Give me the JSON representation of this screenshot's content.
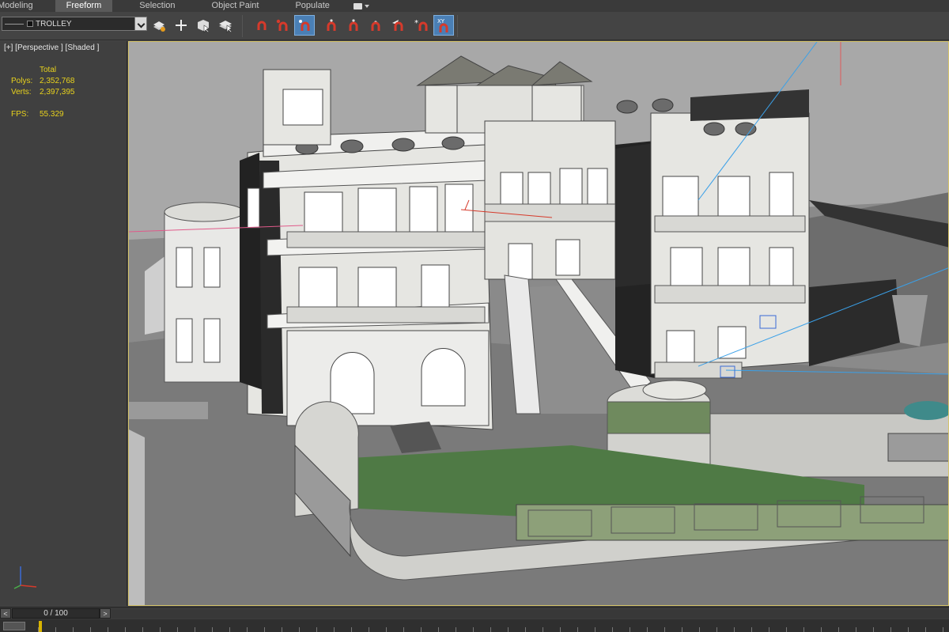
{
  "ribbon": {
    "tabs": [
      {
        "label": "Modeling"
      },
      {
        "label": "Freeform"
      },
      {
        "label": "Selection"
      },
      {
        "label": "Object Paint"
      },
      {
        "label": "Populate"
      }
    ],
    "active_tab": "Freeform"
  },
  "toolbar": {
    "object_name": "TROLLEY",
    "magnet_active_index": 2,
    "xy_label": "XY"
  },
  "viewport": {
    "label": "[+] [Perspective ] [Shaded ]",
    "stats": {
      "total_label": "Total",
      "polys_label": "Polys:",
      "polys_value": "2,352,768",
      "verts_label": "Verts:",
      "verts_value": "2,397,395",
      "fps_label": "FPS:",
      "fps_value": "55.329"
    },
    "colors": {
      "stats_text": "#e8d21d",
      "active_border": "#d6c46a",
      "ground": "#7a7a7a",
      "lawn": "#4f7a45"
    }
  },
  "timeline": {
    "frame_display": "0 / 100",
    "prev_label": "<",
    "next_label": ">"
  }
}
